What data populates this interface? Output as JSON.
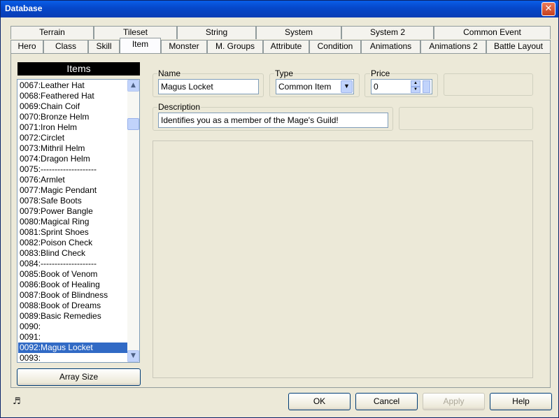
{
  "window": {
    "title": "Database",
    "close_glyph": "✕"
  },
  "tabs_top": [
    {
      "label": "Terrain"
    },
    {
      "label": "Tileset"
    },
    {
      "label": "String"
    },
    {
      "label": "System"
    },
    {
      "label": "System 2"
    },
    {
      "label": "Common Event"
    }
  ],
  "tabs_bottom": [
    {
      "label": "Hero"
    },
    {
      "label": "Class"
    },
    {
      "label": "Skill"
    },
    {
      "label": "Item"
    },
    {
      "label": "Monster"
    },
    {
      "label": "M. Groups"
    },
    {
      "label": "Attribute"
    },
    {
      "label": "Condition"
    },
    {
      "label": "Animations"
    },
    {
      "label": "Animations 2"
    },
    {
      "label": "Battle Layout"
    }
  ],
  "items_list": {
    "header": "Items",
    "selected": "0092:Magus Locket",
    "rows": [
      "0067:Leather Hat",
      "0068:Feathered Hat",
      "0069:Chain Coif",
      "0070:Bronze Helm",
      "0071:Iron Helm",
      "0072:Circlet",
      "0073:Mithril Helm",
      "0074:Dragon Helm",
      "0075:--------------------",
      "0076:Armlet",
      "0077:Magic Pendant",
      "0078:Safe Boots",
      "0079:Power Bangle",
      "0080:Magical Ring",
      "0081:Sprint Shoes",
      "0082:Poison Check",
      "0083:Blind Check",
      "0084:--------------------",
      "0085:Book of Venom",
      "0086:Book of Healing",
      "0087:Book of Blindness",
      "0088:Book of Dreams",
      "0089:Basic Remedies",
      "0090:",
      "0091:",
      "0092:Magus Locket",
      "0093:"
    ],
    "array_size_label": "Array Size"
  },
  "form": {
    "name_label": "Name",
    "name_value": "Magus Locket",
    "type_label": "Type",
    "type_value": "Common Item",
    "price_label": "Price",
    "price_value": "0",
    "description_label": "Description",
    "description_value": "Identifies you as a member of the Mage's Guild!"
  },
  "buttons": {
    "ok": "OK",
    "cancel": "Cancel",
    "apply": "Apply",
    "help": "Help"
  },
  "icons": {
    "scroll_up": "▲",
    "scroll_down": "▼",
    "dropdown": "▼",
    "spin_up": "▲",
    "spin_down": "▼",
    "music": "♬"
  }
}
